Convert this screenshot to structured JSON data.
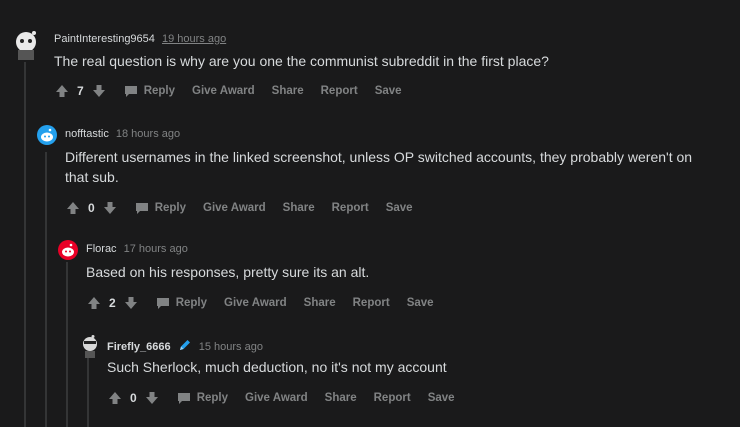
{
  "comments": [
    {
      "username": "PaintInteresting9654",
      "time": "19 hours ago",
      "body": "The real question is why are you one the communist subreddit in the first place?",
      "score": "7"
    },
    {
      "username": "nofftastic",
      "time": "18 hours ago",
      "body": "Different usernames in the linked screenshot, unless OP switched accounts, they probably weren't on that sub.",
      "score": "0"
    },
    {
      "username": "Florac",
      "time": "17 hours ago",
      "body": "Based on his responses, pretty sure its an alt.",
      "score": "2"
    },
    {
      "username": "Firefly_6666",
      "time": "15 hours ago",
      "body": "Such Sherlock, much deduction, no it's not my account",
      "score": "0"
    }
  ],
  "actions": {
    "reply": "Reply",
    "give_award": "Give Award",
    "share": "Share",
    "report": "Report",
    "save": "Save"
  },
  "colors": {
    "background": "#1a1a1b",
    "text": "#d7dadc",
    "muted": "#818384",
    "thread_line": "#343536",
    "accent_blue": "#24a0ed",
    "florac_red": "#ea0027"
  }
}
